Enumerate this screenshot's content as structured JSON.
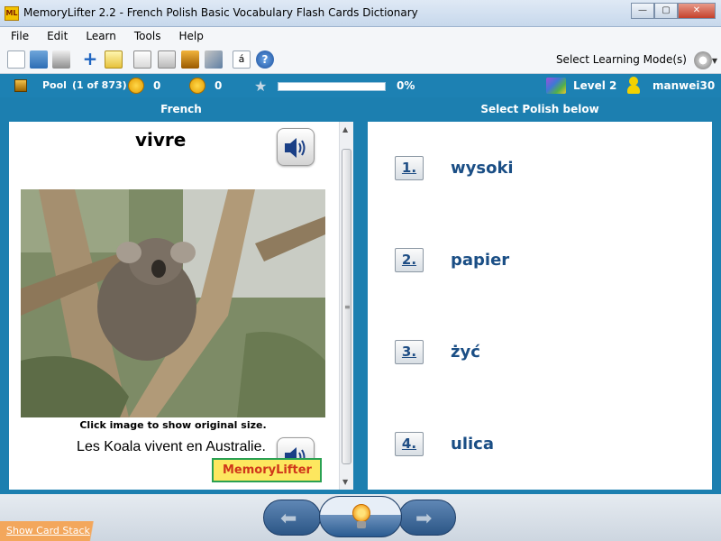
{
  "window": {
    "app_icon_text": "ML",
    "title": "MemoryLifter 2.2 - French Polish Basic Vocabulary Flash Cards Dictionary"
  },
  "menu": [
    "File",
    "Edit",
    "Learn",
    "Tools",
    "Help"
  ],
  "toolbar": {
    "icons": [
      "new-document-icon",
      "open-folder-icon",
      "print-icon",
      "add-card-icon",
      "edit-card-icon",
      "presentation-icon",
      "statistics-icon",
      "card-box-icon",
      "settings-tools-icon",
      "accent-character-icon",
      "help-icon"
    ],
    "accent_label": "á",
    "help_label": "?",
    "mode_label": "Select Learning Mode(s)"
  },
  "status": {
    "pool_label": "Pool",
    "pool_count": "(1 of 873)",
    "happy_count": "0",
    "sad_count": "0",
    "progress_percent": 0,
    "progress_label": "0%",
    "level": "Level 2",
    "username": "manwei30"
  },
  "question": {
    "header": "French",
    "word": "vivre",
    "caption": "Click image to show original size.",
    "sentence": "Les Koala vivent en Australie.",
    "logo_text": "MemoryLifter"
  },
  "answers": {
    "header": "Select Polish below",
    "options": [
      {
        "num": "1.",
        "word": "wysoki"
      },
      {
        "num": "2.",
        "word": "papier"
      },
      {
        "num": "3.",
        "word": "żyć"
      },
      {
        "num": "4.",
        "word": "ulica"
      }
    ]
  },
  "footer": {
    "card_stack_link": "Show Card Stack"
  },
  "colors": {
    "accent_blue": "#1c7fb0",
    "answer_text": "#1a4e85"
  }
}
